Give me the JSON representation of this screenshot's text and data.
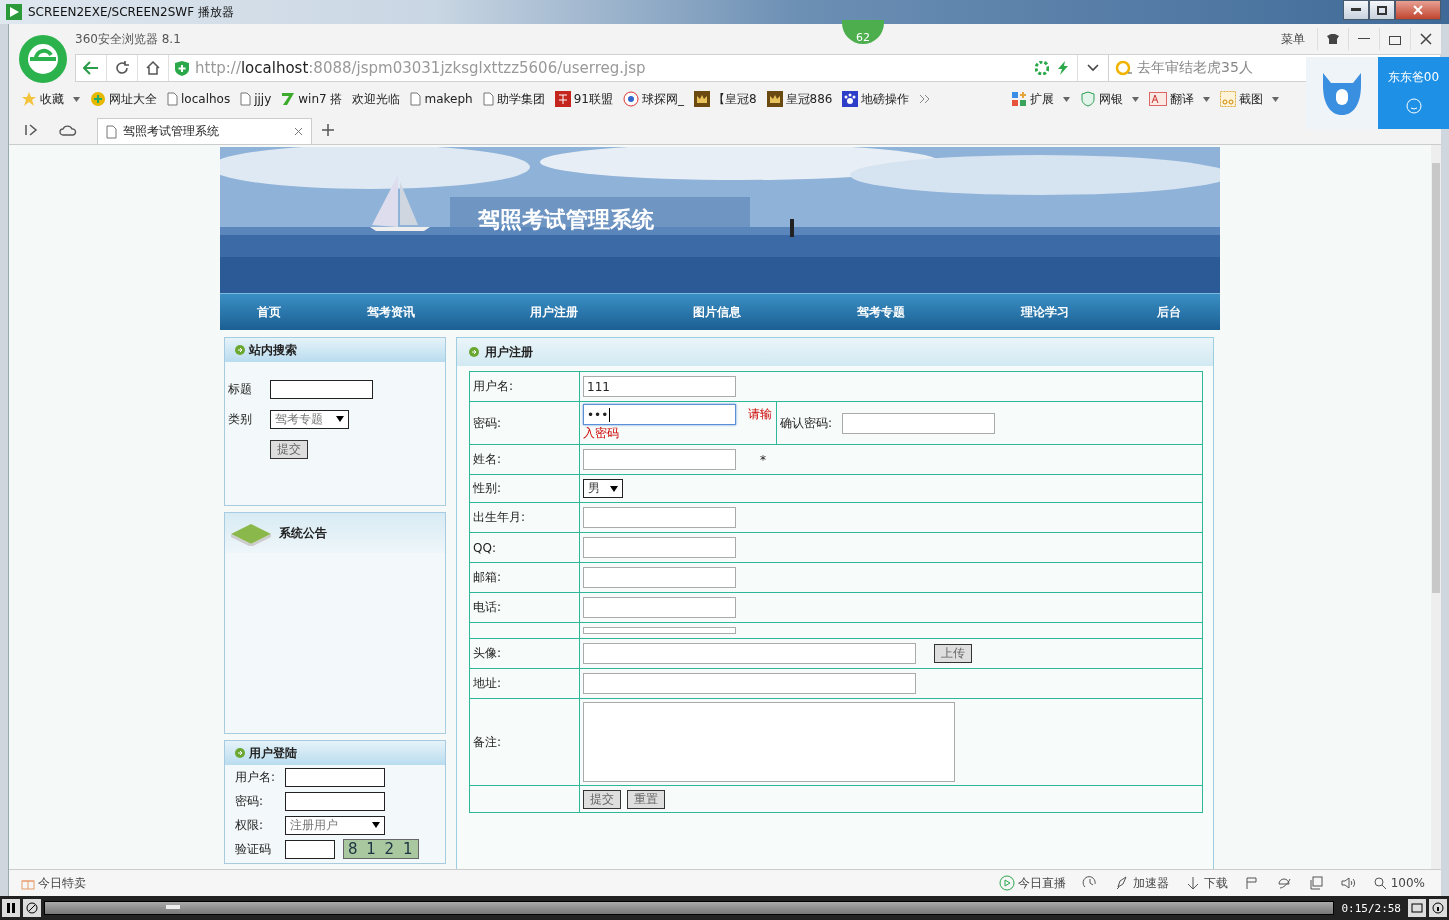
{
  "player": {
    "title": "SCREEN2EXE/SCREEN2SWF 播放器",
    "time": "0:15/2:58",
    "level": 0.094
  },
  "browser": {
    "name": "360安全浏览器 8.1",
    "menu": "菜单",
    "badge": "62",
    "url": {
      "scheme": "http://",
      "host": "localhost",
      "path": ":8088/jspm03031jzksglxttzz5606/userreg.jsp"
    },
    "search_placeholder": "去年审结老虎35人",
    "bookmarks": [
      {
        "label": "收藏",
        "kind": "star"
      },
      {
        "label": "网址大全",
        "kind": "plus"
      },
      {
        "label": "localhos",
        "kind": "page"
      },
      {
        "label": "jjjy",
        "kind": "page"
      },
      {
        "label": "win7 搭",
        "kind": "seven"
      },
      {
        "label": "欢迎光临",
        "kind": "none"
      },
      {
        "label": "makeph",
        "kind": "page"
      },
      {
        "label": "助学集团",
        "kind": "page"
      },
      {
        "label": "91联盟",
        "kind": "red"
      },
      {
        "label": "球探网_",
        "kind": "ball"
      },
      {
        "label": "【皇冠8",
        "kind": "gold"
      },
      {
        "label": "皇冠886",
        "kind": "gold"
      },
      {
        "label": "地磅操作",
        "kind": "paw"
      }
    ],
    "tools": [
      {
        "label": "扩展",
        "kind": "grid"
      },
      {
        "label": "网银",
        "kind": "shield"
      },
      {
        "label": "翻译",
        "kind": "translate"
      },
      {
        "label": "截图",
        "kind": "scissors"
      }
    ],
    "tabs": [
      {
        "label": "驾照考试管理系统",
        "selected": true
      }
    ],
    "popup": {
      "label": "东东爸00"
    },
    "status_left": "今日特卖",
    "status_items": [
      {
        "label": "今日直播",
        "kind": "play"
      },
      {
        "kind": "speed"
      },
      {
        "label": "加速器",
        "kind": "rocket"
      },
      {
        "label": "下载",
        "kind": "download"
      },
      {
        "kind": "flag"
      },
      {
        "kind": "ie"
      },
      {
        "kind": "window"
      },
      {
        "kind": "sound"
      },
      {
        "label": "100%",
        "kind": "zoom"
      }
    ]
  },
  "site": {
    "title": "驾照考试管理系统",
    "nav": [
      {
        "label": "首页"
      },
      {
        "label": "驾考资讯"
      },
      {
        "label": "用户注册"
      },
      {
        "label": "图片信息"
      },
      {
        "label": "驾考专题"
      },
      {
        "label": "理论学习"
      },
      {
        "label": "后台"
      }
    ],
    "search": {
      "title": "站内搜索",
      "title_label": "标题",
      "category_label": "类别",
      "category_value": "驾考专题",
      "button": "提交"
    },
    "notice": {
      "title": "系统公告"
    },
    "login": {
      "title": "用户登陆",
      "username_label": "用户名:",
      "password_label": "密码:",
      "role_label": "权限:",
      "role_value": "注册用户",
      "captcha_label": "验证码",
      "captcha": "8 1 2 1"
    },
    "register": {
      "title": "用户注册",
      "rows": [
        {
          "label": "用户名:",
          "kind": "text",
          "value": "111"
        },
        {
          "label": "密码:",
          "kind": "password",
          "value": "•••",
          "focused": true,
          "hint_lines": [
            "请输",
            "入密码"
          ],
          "confirm_label": "确认密码:"
        },
        {
          "label": "姓名:",
          "kind": "text",
          "required": "*"
        },
        {
          "label": "性别:",
          "kind": "select",
          "value": "男"
        },
        {
          "label": "出生年月:",
          "kind": "text"
        },
        {
          "label": "QQ:",
          "kind": "text"
        },
        {
          "label": "邮箱:",
          "kind": "text"
        },
        {
          "label": "电话:",
          "kind": "text"
        },
        {
          "kind": "thin"
        },
        {
          "label": "头像:",
          "kind": "file",
          "button": "上传"
        },
        {
          "label": "地址:",
          "kind": "wide"
        },
        {
          "label": "备注:",
          "kind": "textarea"
        },
        {
          "kind": "buttons",
          "buttons": [
            "提交",
            "重置"
          ]
        }
      ]
    }
  }
}
